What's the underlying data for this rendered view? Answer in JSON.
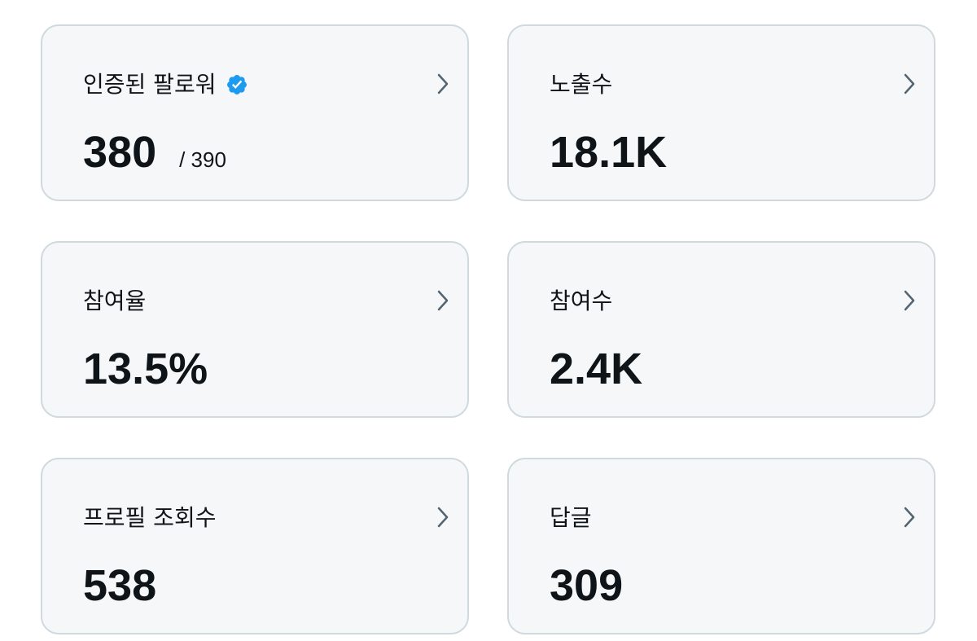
{
  "cards": [
    {
      "label": "인증된 팔로워",
      "value": "380",
      "sub": "/ 390",
      "verified": true
    },
    {
      "label": "노출수",
      "value": "18.1K"
    },
    {
      "label": "참여율",
      "value": "13.5%"
    },
    {
      "label": "참여수",
      "value": "2.4K"
    },
    {
      "label": "프로필 조회수",
      "value": "538"
    },
    {
      "label": "답글",
      "value": "309"
    }
  ],
  "icons": {
    "verified": "verified-badge-icon",
    "chevron": "chevron-right-icon"
  },
  "colors": {
    "card_background": "#f6f7f8",
    "card_border": "#cfd9de",
    "text": "#0f1419",
    "chevron": "#536471",
    "verified_badge": "#1d9bf0"
  }
}
